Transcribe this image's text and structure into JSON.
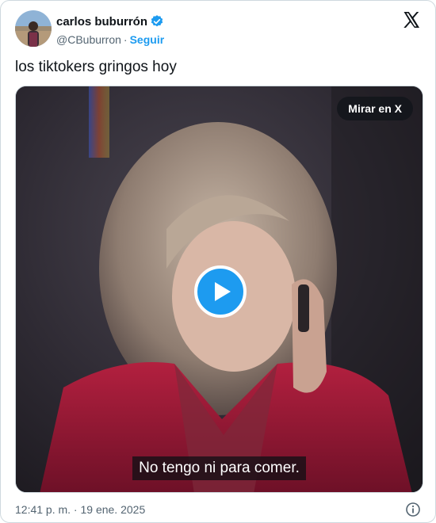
{
  "tweet": {
    "author": {
      "name": "carlos buburrón",
      "handle": "@CBuburron",
      "separator": "·",
      "follow_label": "Seguir"
    },
    "text": "los tiktokers gringos hoy",
    "media": {
      "watch_label": "Mirar en X",
      "subtitle": "No tengo ni para comer."
    },
    "timestamp": "12:41 p. m. · 19 ene. 2025"
  },
  "icons": {
    "verified": "verified-badge-icon",
    "logo": "x-logo-icon",
    "play": "play-icon",
    "info": "info-icon"
  },
  "colors": {
    "accent": "#1d9bf0",
    "text_primary": "#0f1419",
    "text_secondary": "#536471",
    "border": "#cfd9de"
  }
}
